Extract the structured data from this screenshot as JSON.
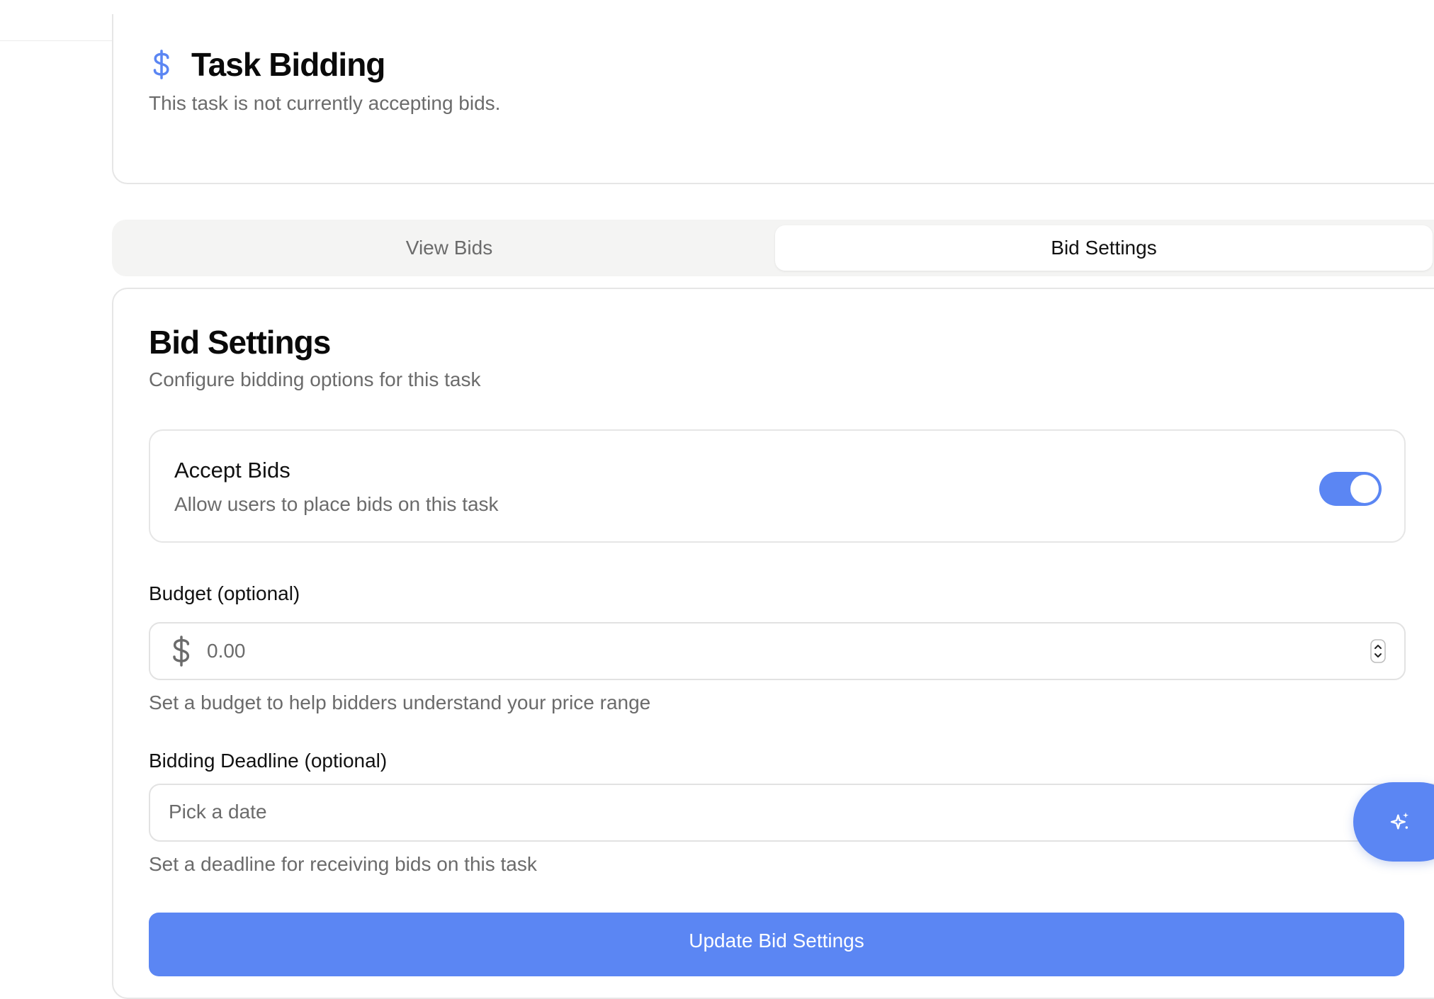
{
  "header": {
    "icon": "dollar-icon",
    "title": "Task Bidding",
    "subtitle": "This task is not currently accepting bids."
  },
  "tabs": [
    {
      "label": "View Bids",
      "active": false
    },
    {
      "label": "Bid Settings",
      "active": true
    }
  ],
  "settings": {
    "title": "Bid Settings",
    "description": "Configure bidding options for this task",
    "accept_bids": {
      "title": "Accept Bids",
      "description": "Allow users to place bids on this task",
      "enabled": true
    },
    "budget": {
      "label": "Budget (optional)",
      "placeholder": "0.00",
      "value": "",
      "helper": "Set a budget to help bidders understand your price range"
    },
    "deadline": {
      "label": "Bidding Deadline (optional)",
      "placeholder": "Pick a date",
      "helper": "Set a deadline for receiving bids on this task"
    },
    "submit_label": "Update Bid Settings"
  },
  "fab": {
    "icon": "sparkles-icon"
  },
  "colors": {
    "accent": "#5b86f3",
    "muted_text": "#6b6b6b",
    "tab_bg": "#f4f4f3",
    "border": "#e6e6e6"
  }
}
